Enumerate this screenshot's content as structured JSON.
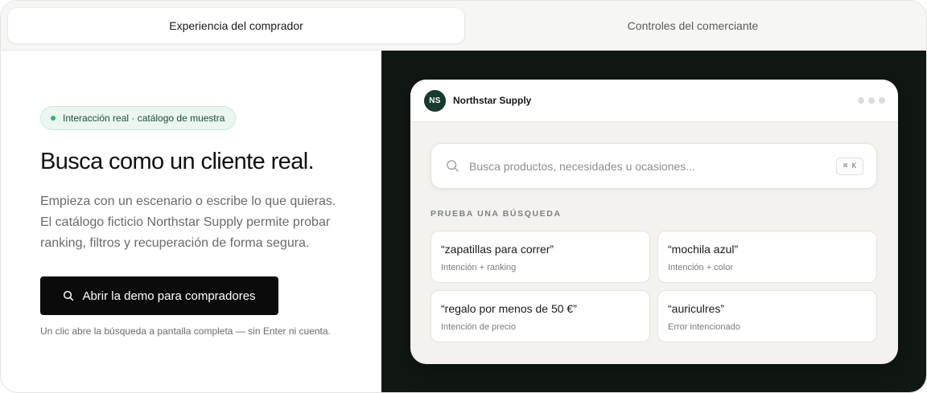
{
  "tabs": [
    {
      "label": "Experiencia del comprador",
      "active": true
    },
    {
      "label": "Controles del comerciante",
      "active": false
    }
  ],
  "left": {
    "badge": "Interacción real · catálogo de muestra",
    "headline": "Busca como un cliente real.",
    "description_lines": [
      "Empieza con un escenario o escribe lo que quieras.",
      "El catálogo ficticio Northstar Supply permite probar",
      "ranking, filtros y recuperación de forma segura."
    ],
    "cta_label": "Abrir la demo para compradores",
    "note": "Un clic abre la búsqueda a pantalla completa — sin Enter ni cuenta."
  },
  "store": {
    "initials": "NS",
    "name": "Northstar Supply",
    "search_placeholder": "Busca productos, necesidades u ocasiones...",
    "shortcut": "⌘ K",
    "section_label": "PRUEBA UNA BÚSQUEDA",
    "suggestions": [
      {
        "title": "“zapatillas para correr”",
        "subtitle": "Intención + ranking"
      },
      {
        "title": "“mochila azul”",
        "subtitle": "Intención + color"
      },
      {
        "title": "“regalo por menos de 50 €”",
        "subtitle": "Intención de precio"
      },
      {
        "title": "“auriculres”",
        "subtitle": "Error intencionado"
      }
    ]
  },
  "colors": {
    "accent_dark": "#0b0b0b",
    "badge_green": "#2bb673",
    "panel_dark": "#111814",
    "avatar": "#163a2e"
  },
  "icons": [
    "search-icon",
    "status-dot-icon",
    "window-dots-icon"
  ]
}
